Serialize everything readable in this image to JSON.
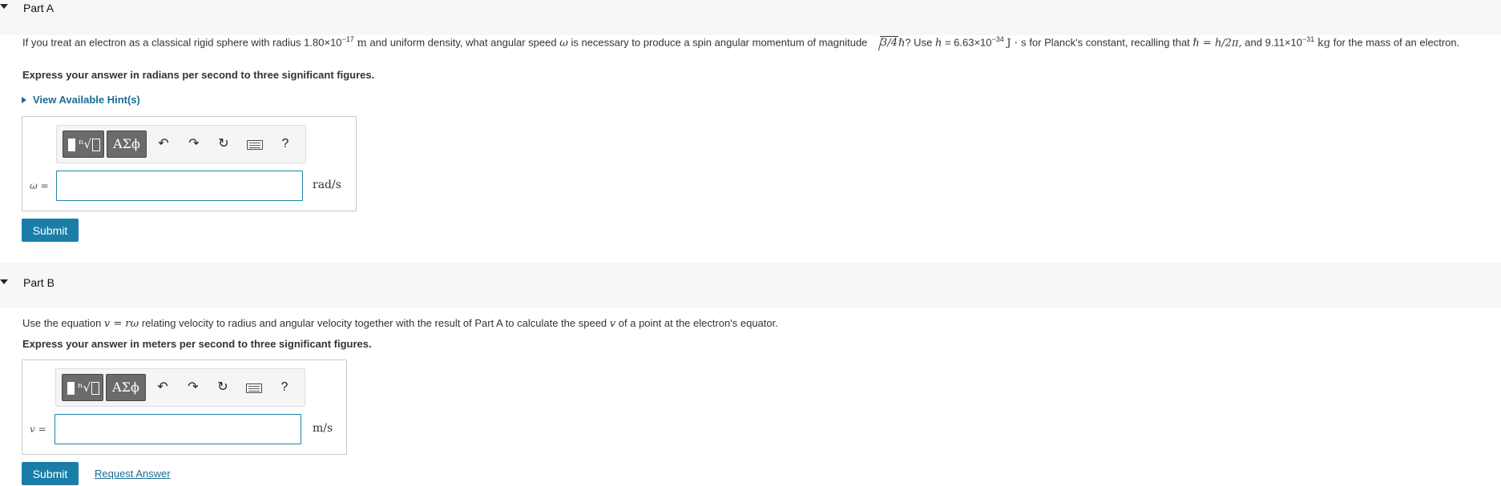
{
  "part_a": {
    "title": "Part A",
    "question": {
      "t1": "If you treat an electron as a classical rigid sphere with radius 1.80×10",
      "r_exp": "−17",
      "m_unit": "m",
      "t2": "and uniform density, what angular speed",
      "omega": "ω",
      "t3": "is necessary to produce a spin angular momentum of magnitude",
      "sqrt_arg": "3/4",
      "hbar": "ℏ",
      "t4": "? Use",
      "h": "h",
      "t5": "= 6.63×10",
      "h_exp": "−34",
      "js_unit": "J · s",
      "t6": "for Planck's constant, recalling that",
      "hbar_eq": "ℏ = h/2π,",
      "t7": "and 9.11×10",
      "m_exp": "−31",
      "kg_unit": "kg",
      "t8": "for the mass of an electron."
    },
    "instruction": "Express your answer in radians per second to three significant figures.",
    "hint_link": "View Available Hint(s)",
    "toolbar": {
      "greek_label": "ΑΣϕ",
      "help_label": "?"
    },
    "var_label": "ω =",
    "unit": "rad/s",
    "submit_label": "Submit"
  },
  "part_b": {
    "title": "Part B",
    "question": {
      "t1": "Use the equation",
      "eq": "v = rω",
      "t2": "relating velocity to radius and angular velocity together with the result of Part A to calculate the speed",
      "v": "v",
      "t3": "of a point at the electron's equator."
    },
    "instruction": "Express your answer in meters per second to three significant figures.",
    "toolbar": {
      "greek_label": "ΑΣϕ",
      "help_label": "?"
    },
    "var_label": "v =",
    "unit": "m/s",
    "submit_label": "Submit",
    "request_answer_label": "Request Answer"
  },
  "icons": {
    "collapse": "caret-down-icon",
    "hint": "triangle-right-icon",
    "templates": "templates-icon",
    "greek": "greek-symbols-icon",
    "undo": "undo-icon",
    "redo": "redo-icon",
    "reset": "reset-icon",
    "keyboard": "keyboard-icon",
    "help": "help-icon"
  },
  "colors": {
    "accent": "#1a7ea8",
    "link": "#1a6c93",
    "header_bg": "#f7f7f7",
    "toolbar_button": "#6b6b6b"
  }
}
